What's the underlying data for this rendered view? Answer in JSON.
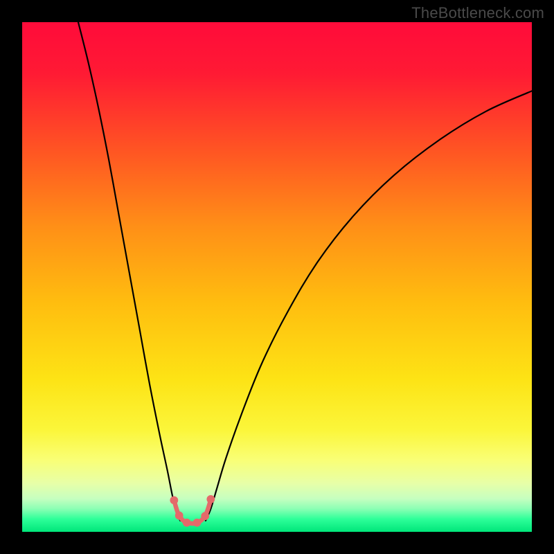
{
  "attribution": "TheBottleneck.com",
  "chart_data": {
    "type": "line",
    "title": "",
    "xlabel": "",
    "ylabel": "",
    "xlim": [
      0,
      100
    ],
    "ylim": [
      0,
      100
    ],
    "grid": false,
    "legend": false,
    "background": {
      "gradient_stops": [
        {
          "pos": 0.0,
          "color": "#ff0b3a"
        },
        {
          "pos": 0.1,
          "color": "#ff1a34"
        },
        {
          "pos": 0.25,
          "color": "#ff5423"
        },
        {
          "pos": 0.4,
          "color": "#ff8f17"
        },
        {
          "pos": 0.55,
          "color": "#ffbd0f"
        },
        {
          "pos": 0.7,
          "color": "#fde315"
        },
        {
          "pos": 0.8,
          "color": "#fbf63a"
        },
        {
          "pos": 0.86,
          "color": "#f9ff77"
        },
        {
          "pos": 0.905,
          "color": "#e7ffa8"
        },
        {
          "pos": 0.935,
          "color": "#c6ffc0"
        },
        {
          "pos": 0.955,
          "color": "#8affb4"
        },
        {
          "pos": 0.975,
          "color": "#2dff99"
        },
        {
          "pos": 1.0,
          "color": "#00e67a"
        }
      ]
    },
    "series": [
      {
        "name": "left-branch",
        "stroke": "#000000",
        "stroke_width": 2.2,
        "points": [
          {
            "x": 11.0,
            "y": 100.0
          },
          {
            "x": 13.0,
            "y": 92.0
          },
          {
            "x": 15.0,
            "y": 83.0
          },
          {
            "x": 17.0,
            "y": 73.0
          },
          {
            "x": 19.0,
            "y": 62.0
          },
          {
            "x": 21.0,
            "y": 51.0
          },
          {
            "x": 23.0,
            "y": 40.0
          },
          {
            "x": 25.0,
            "y": 29.0
          },
          {
            "x": 27.0,
            "y": 19.0
          },
          {
            "x": 28.5,
            "y": 12.0
          },
          {
            "x": 29.5,
            "y": 7.0
          },
          {
            "x": 30.3,
            "y": 4.0
          },
          {
            "x": 31.0,
            "y": 2.2
          }
        ]
      },
      {
        "name": "right-branch",
        "stroke": "#000000",
        "stroke_width": 2.2,
        "points": [
          {
            "x": 36.0,
            "y": 2.2
          },
          {
            "x": 37.0,
            "y": 4.5
          },
          {
            "x": 38.2,
            "y": 8.5
          },
          {
            "x": 40.0,
            "y": 14.5
          },
          {
            "x": 43.0,
            "y": 23.0
          },
          {
            "x": 47.0,
            "y": 33.0
          },
          {
            "x": 52.0,
            "y": 43.0
          },
          {
            "x": 58.0,
            "y": 53.0
          },
          {
            "x": 65.0,
            "y": 62.0
          },
          {
            "x": 73.0,
            "y": 70.0
          },
          {
            "x": 82.0,
            "y": 77.0
          },
          {
            "x": 91.0,
            "y": 82.5
          },
          {
            "x": 100.0,
            "y": 86.5
          }
        ]
      },
      {
        "name": "valley-overlay",
        "stroke": "#e46a6a",
        "stroke_width": 6.5,
        "points": [
          {
            "x": 29.8,
            "y": 6.2
          },
          {
            "x": 30.6,
            "y": 3.6
          },
          {
            "x": 31.6,
            "y": 2.2
          },
          {
            "x": 32.8,
            "y": 1.7
          },
          {
            "x": 34.0,
            "y": 1.7
          },
          {
            "x": 35.2,
            "y": 2.3
          },
          {
            "x": 36.2,
            "y": 3.8
          },
          {
            "x": 37.0,
            "y": 6.3
          }
        ]
      }
    ],
    "markers": [
      {
        "x": 29.8,
        "y": 6.2,
        "r": 5.9,
        "color": "#e46a6a"
      },
      {
        "x": 30.8,
        "y": 3.2,
        "r": 5.9,
        "color": "#e46a6a"
      },
      {
        "x": 32.3,
        "y": 1.8,
        "r": 5.9,
        "color": "#e46a6a"
      },
      {
        "x": 34.3,
        "y": 1.8,
        "r": 5.9,
        "color": "#e46a6a"
      },
      {
        "x": 35.9,
        "y": 3.1,
        "r": 5.9,
        "color": "#e46a6a"
      },
      {
        "x": 37.0,
        "y": 6.4,
        "r": 5.9,
        "color": "#e46a6a"
      }
    ]
  }
}
